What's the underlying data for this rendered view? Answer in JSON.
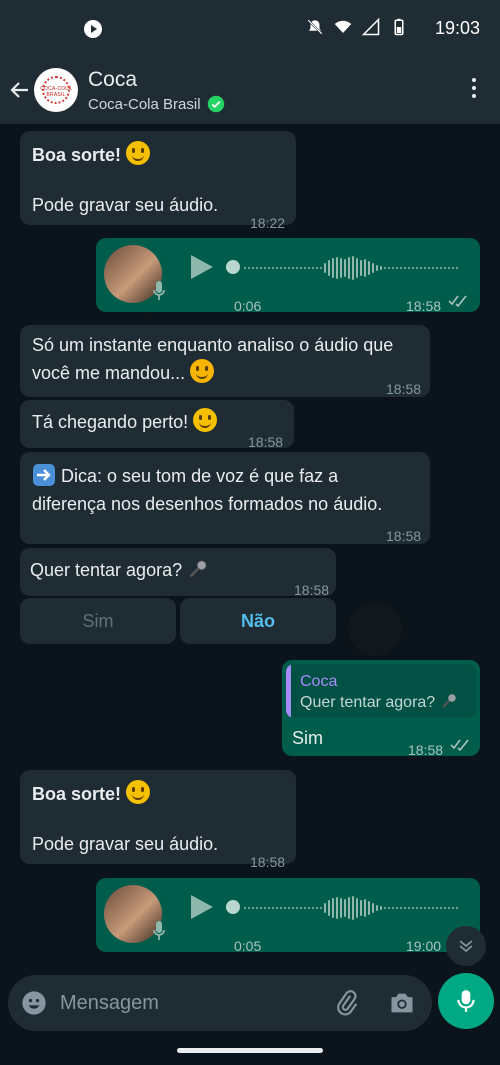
{
  "status_bar": {
    "time": "19:03"
  },
  "header": {
    "title": "Coca",
    "subtitle": "Coca-Cola Brasil",
    "avatar_text": "COCA-COLA BRASIL"
  },
  "messages": {
    "m1": {
      "title": "Boa sorte!",
      "body": "Pode gravar seu áudio.",
      "time": "18:22"
    },
    "a1": {
      "duration": "0:06",
      "time": "18:58"
    },
    "m2": {
      "line1": "Só um instante enquanto analiso o áudio que",
      "line2": "você me mandou...",
      "time": "18:58"
    },
    "m3": {
      "text": "Tá chegando perto!",
      "time": "18:58"
    },
    "m4": {
      "line1": "Dica: o seu tom de voz é que faz a",
      "line2": "diferença nos desenhos formados no áudio.",
      "time": "18:58"
    },
    "m5": {
      "text": "Quer tentar agora?",
      "time": "18:58"
    },
    "quick_replies": {
      "yes": "Sim",
      "no": "Não"
    },
    "reply": {
      "quote_author": "Coca",
      "quote_text": "Quer tentar agora?",
      "text": "Sim",
      "time": "18:58"
    },
    "m6": {
      "title": "Boa sorte!",
      "body": "Pode gravar seu áudio.",
      "time": "18:58"
    },
    "a2": {
      "duration": "0:05",
      "time": "19:00"
    }
  },
  "composer": {
    "placeholder": "Mensagem"
  }
}
